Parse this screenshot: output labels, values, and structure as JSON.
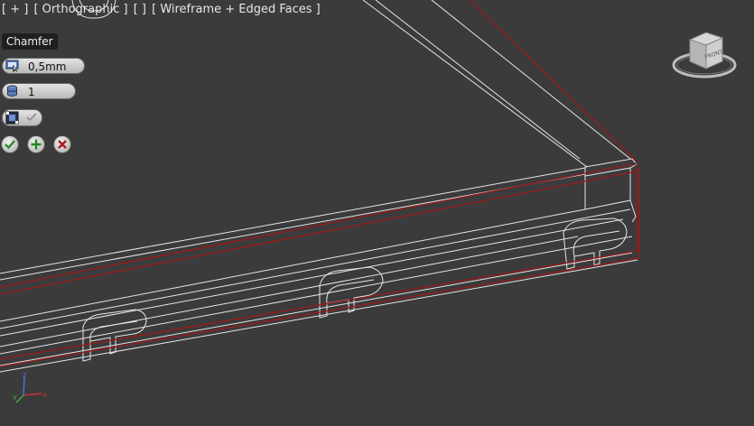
{
  "viewport": {
    "label_plus": "[ + ]",
    "label_view": "[ Orthographic ]",
    "label_extra": "[ ]",
    "label_shading": "[ Wireframe + Edged Faces ]"
  },
  "caddy": {
    "title": "Chamfer",
    "amount": {
      "icon": "chamfer-amount-icon",
      "value": "0,5mm"
    },
    "segments": {
      "icon": "segments-icon",
      "value": "1"
    },
    "open_toggle": {
      "icon": "open-chamfer-icon",
      "check_icon": "check-icon"
    },
    "ok_icon": "ok-check-icon",
    "apply_icon": "apply-plus-icon",
    "cancel_icon": "cancel-x-icon"
  },
  "viewcube": {
    "face_label": "FRONT"
  },
  "axis_tripod": {
    "x": "x",
    "y": "y",
    "z": "z"
  },
  "colors": {
    "background": "#3b3b3b",
    "wire_white": "#e8e8e8",
    "wire_red": "#a01818"
  }
}
